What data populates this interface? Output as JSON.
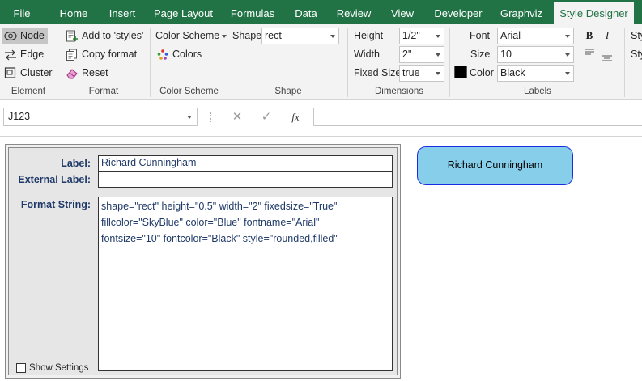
{
  "tabs": [
    {
      "label": "File",
      "active": false
    },
    {
      "label": "Home",
      "active": false
    },
    {
      "label": "Insert",
      "active": false
    },
    {
      "label": "Page Layout",
      "active": false
    },
    {
      "label": "Formulas",
      "active": false
    },
    {
      "label": "Data",
      "active": false
    },
    {
      "label": "Review",
      "active": false
    },
    {
      "label": "View",
      "active": false
    },
    {
      "label": "Developer",
      "active": false
    },
    {
      "label": "Graphviz",
      "active": false
    },
    {
      "label": "Style Designer",
      "active": true
    }
  ],
  "ribbon": {
    "element": {
      "group_label": "Element",
      "node_label": "Node",
      "edge_label": "Edge",
      "cluster_label": "Cluster",
      "selected": "Node"
    },
    "format": {
      "group_label": "Format",
      "add_to_styles_label": "Add to 'styles'",
      "copy_format_label": "Copy format",
      "reset_label": "Reset"
    },
    "color_scheme": {
      "group_label": "Color Scheme",
      "menu_label": "Color Scheme",
      "colors_label": "Colors"
    },
    "shape": {
      "group_label": "Shape",
      "label": "Shape",
      "value": "rect"
    },
    "dimensions": {
      "group_label": "Dimensions",
      "height_label": "Height",
      "height_value": "1/2\"",
      "width_label": "Width",
      "width_value": "2\"",
      "fixed_size_label": "Fixed Size",
      "fixed_size_value": "true"
    },
    "labels": {
      "group_label": "Labels",
      "font_label": "Font",
      "font_value": "Arial",
      "size_label": "Size",
      "size_value": "10",
      "color_label": "Color",
      "color_value": "Black",
      "color_swatch": "#000000",
      "bold_label": "B",
      "italic_label": "I"
    },
    "styles_partial": [
      "Sty",
      "Sty"
    ]
  },
  "formula_bar": {
    "name_box": "J123",
    "cancel_icon": "✕",
    "enter_icon": "✓",
    "fx_label": "fx",
    "formula": ""
  },
  "form": {
    "label_caption": "Label:",
    "label_value": "Richard Cunningham",
    "external_label_caption": "External Label:",
    "external_label_value": "",
    "format_string_caption": "Format String:",
    "format_string_value": "shape=\"rect\" height=\"0.5\" width=\"2\" fixedsize=\"True\"\nfillcolor=\"SkyBlue\" color=\"Blue\" fontname=\"Arial\"\nfontsize=\"10\" fontcolor=\"Black\" style=\"rounded,filled\"",
    "show_settings_label": "Show Settings",
    "show_settings_checked": false
  },
  "preview": {
    "label": "Richard Cunningham",
    "fill_color": "#87CEEB",
    "border_color": "#1A2CE0",
    "font_color": "#000000"
  },
  "colors": {
    "ribbon_accent": "#217346",
    "form_label_text": "#1F3A68"
  }
}
